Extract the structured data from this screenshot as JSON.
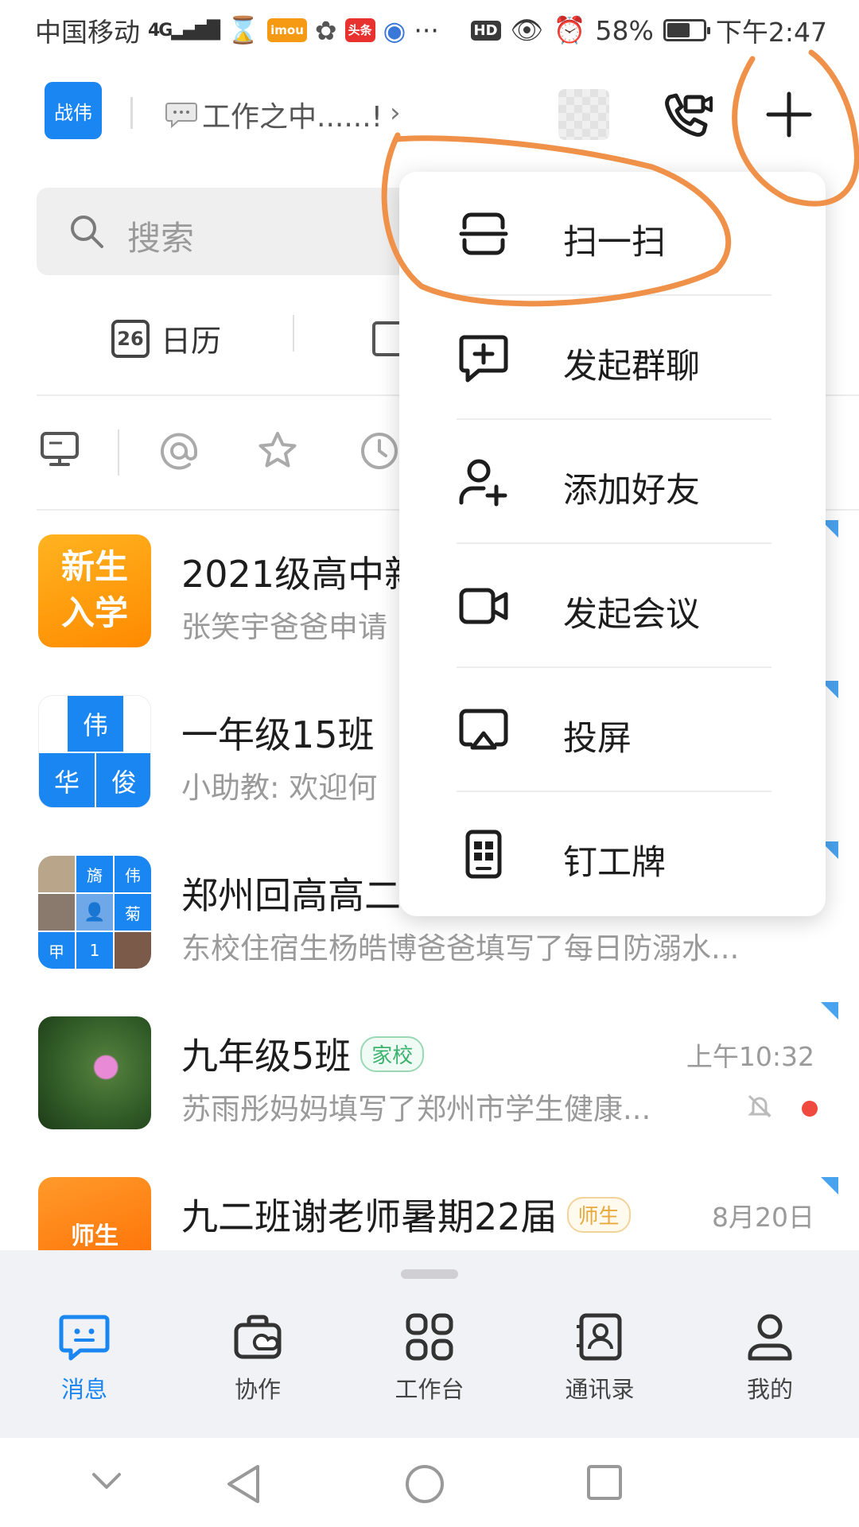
{
  "statusbar": {
    "carrier": "中国移动",
    "network": "4G",
    "app_badge_1": "imou",
    "app_badge_2": "头条",
    "more": "···",
    "hd": "HD",
    "battery": "58%",
    "time": "下午2:47"
  },
  "header": {
    "user_badge": "战伟",
    "work_status": "工作之中......!"
  },
  "search": {
    "placeholder": "搜索"
  },
  "quick": {
    "calendar_day": "26",
    "calendar_label": "日历"
  },
  "chats": [
    {
      "title": "2021级高中新",
      "preview": "张笑宇爸爸申请",
      "avatar_text": [
        "新生",
        "入学"
      ]
    },
    {
      "title": "一年级15班",
      "preview": "小助教: 欢迎何",
      "avatar_text": [
        "伟",
        "华",
        "俊"
      ]
    },
    {
      "title": "郑州回高高二",
      "preview": "东校住宿生杨皓博爸爸填写了每日防溺水...",
      "avatar_text": [
        "旖",
        "伟",
        "菊",
        "甲",
        "1"
      ]
    },
    {
      "title": "九年级5班",
      "tag": "家校",
      "time": "上午10:32",
      "preview": "苏雨彤妈妈填写了郑州市学生健康..."
    },
    {
      "title": "九二班谢老师暑期22届",
      "tag": "师生",
      "time": "8月20日",
      "avatar_text": "师生"
    }
  ],
  "menu": {
    "items": [
      {
        "label": "扫一扫",
        "icon": "scan-icon"
      },
      {
        "label": "发起群聊",
        "icon": "group-chat-icon"
      },
      {
        "label": "添加好友",
        "icon": "add-friend-icon"
      },
      {
        "label": "发起会议",
        "icon": "video-meeting-icon"
      },
      {
        "label": "投屏",
        "icon": "screen-cast-icon"
      },
      {
        "label": "钉工牌",
        "icon": "badge-card-icon"
      }
    ]
  },
  "tabbar": {
    "tabs": [
      {
        "label": "消息",
        "icon": "message-icon",
        "active": true
      },
      {
        "label": "协作",
        "icon": "collaborate-icon"
      },
      {
        "label": "工作台",
        "icon": "workbench-icon"
      },
      {
        "label": "通讯录",
        "icon": "contacts-icon"
      },
      {
        "label": "我的",
        "icon": "profile-icon"
      }
    ]
  },
  "colors": {
    "accent": "#1a86f2",
    "annotation": "#f0914a",
    "tag_green": "#3bb36f",
    "tag_yellow": "#e8a83a",
    "unread": "#f04a3e"
  }
}
